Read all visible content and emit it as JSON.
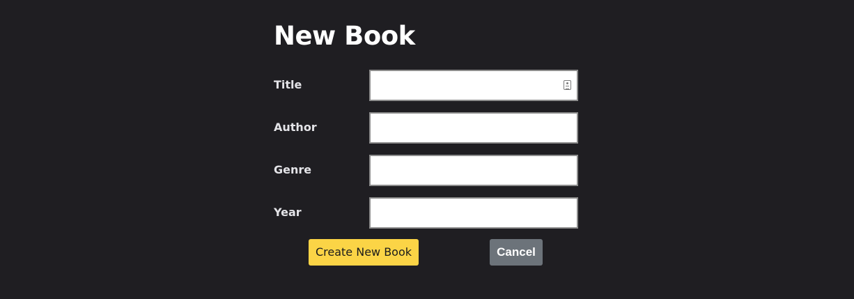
{
  "page": {
    "title": "New Book"
  },
  "form": {
    "fields": [
      {
        "label": "Title",
        "value": "",
        "placeholder": ""
      },
      {
        "label": "Author",
        "value": "",
        "placeholder": ""
      },
      {
        "label": "Genre",
        "value": "",
        "placeholder": ""
      },
      {
        "label": "Year",
        "value": "",
        "placeholder": ""
      }
    ],
    "title_autofill_icon": "contact-card-icon",
    "buttons": {
      "create_label": "Create New Book",
      "cancel_label": "Cancel"
    }
  },
  "colors": {
    "background": "#1f1e22",
    "create_button": "#fbd446",
    "cancel_button": "#6c737a"
  }
}
